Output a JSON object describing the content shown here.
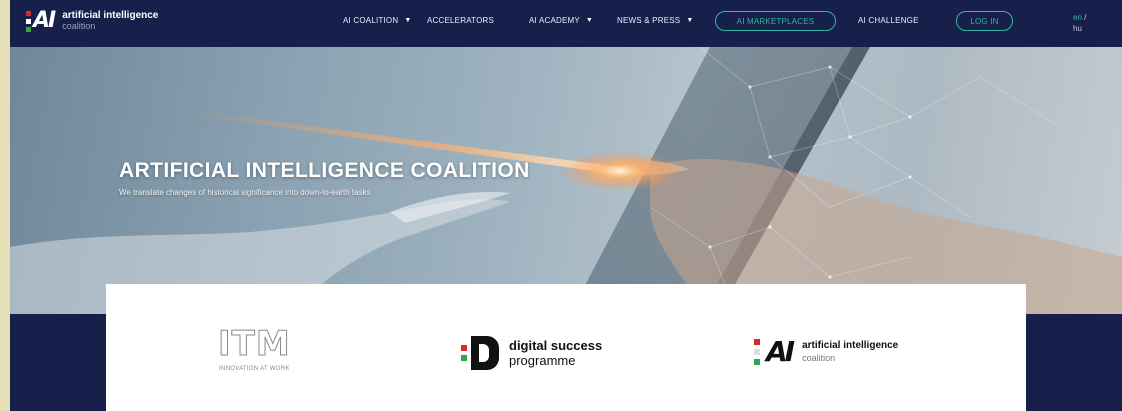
{
  "brand": {
    "logo_mark": "AI",
    "line1": "artificial intelligence",
    "line2": "coalition"
  },
  "nav": {
    "items": [
      {
        "label": "AI COALITION",
        "has_caret": true
      },
      {
        "label": "ACCELERATORS",
        "has_caret": false
      },
      {
        "label": "AI ACADEMY",
        "has_caret": true
      },
      {
        "label": "NEWS & PRESS",
        "has_caret": true
      },
      {
        "label": "AI MARKETPLACES",
        "pill": true
      },
      {
        "label": "AI CHALLENGE",
        "has_caret": false
      },
      {
        "label": "LOG IN",
        "pill": true
      }
    ],
    "caret_glyph": "▼",
    "lang_en": "en",
    "lang_sep": "/",
    "lang_hu": "hu"
  },
  "hero": {
    "title": "ARTIFICIAL INTELLIGENCE COALITION",
    "subtitle": "We translate changes of historical significance into down-to-earth tasks"
  },
  "partners": {
    "itm": {
      "mark": "ITM",
      "tagline": "INNOVATION AT WORK"
    },
    "dsp": {
      "line1": "digital success",
      "line2": "programme"
    },
    "aic": {
      "mark": "AI",
      "line1": "artificial intelligence",
      "line2": "coalition"
    }
  },
  "colors": {
    "navy": "#16204a",
    "teal_accent": "#2fb8a0",
    "flag_red": "#d42a2a",
    "flag_green": "#2aa84a"
  }
}
